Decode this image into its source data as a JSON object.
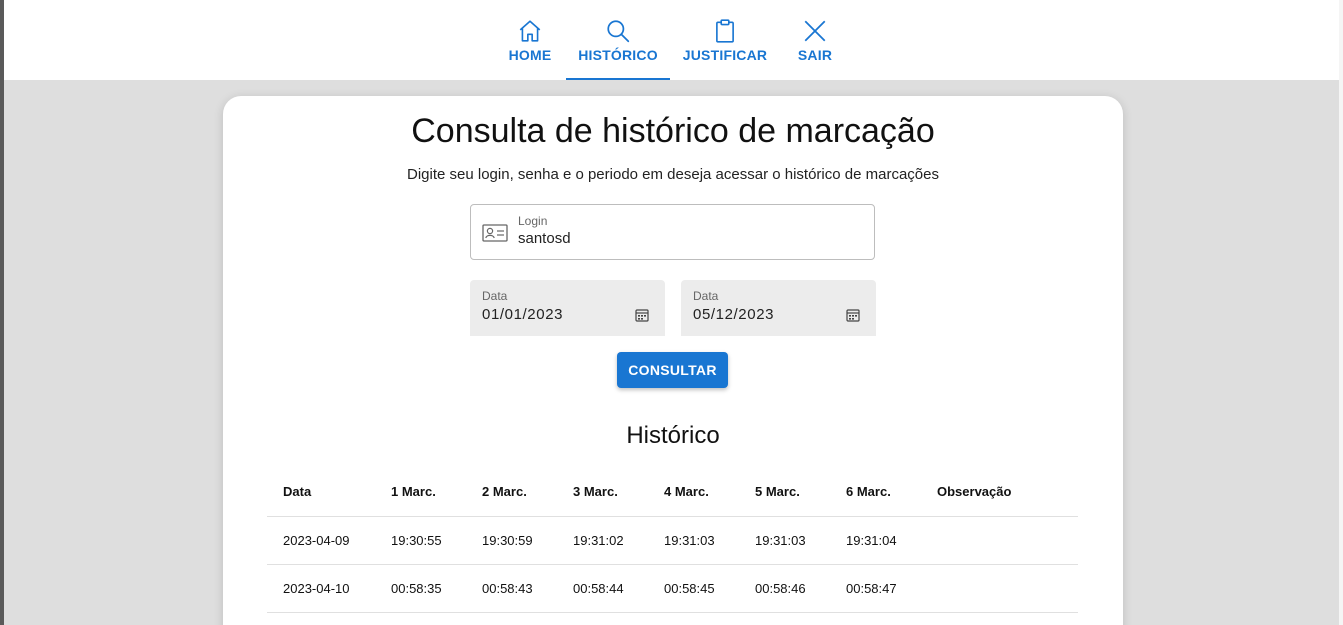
{
  "nav": {
    "tabs": [
      {
        "label": "HOME",
        "icon": "home-icon",
        "active": false
      },
      {
        "label": "HISTÓRICO",
        "icon": "search-icon",
        "active": true
      },
      {
        "label": "JUSTIFICAR",
        "icon": "clipboard-icon",
        "active": false
      },
      {
        "label": "SAIR",
        "icon": "close-icon",
        "active": false
      }
    ]
  },
  "page": {
    "title": "Consulta de histórico de marcação",
    "subtitle": "Digite seu login, senha e o periodo em deseja acessar o histórico de marcações"
  },
  "form": {
    "login": {
      "label": "Login",
      "value": "santosd",
      "icon": "id-card-icon"
    },
    "date_start": {
      "label": "Data",
      "value": "01/01/2023",
      "icon": "calendar-icon"
    },
    "date_end": {
      "label": "Data",
      "value": "05/12/2023",
      "icon": "calendar-icon"
    },
    "submit_label": "CONSULTAR"
  },
  "history": {
    "title": "Histórico",
    "columns": [
      "Data",
      "1 Marc.",
      "2 Marc.",
      "3 Marc.",
      "4 Marc.",
      "5 Marc.",
      "6 Marc.",
      "Observação"
    ],
    "rows": [
      [
        "2023-04-09",
        "19:30:55",
        "19:30:59",
        "19:31:02",
        "19:31:03",
        "19:31:03",
        "19:31:04",
        ""
      ],
      [
        "2023-04-10",
        "00:58:35",
        "00:58:43",
        "00:58:44",
        "00:58:45",
        "00:58:46",
        "00:58:47",
        ""
      ]
    ]
  },
  "colors": {
    "accent": "#1976d2",
    "background": "#dedede",
    "card": "#ffffff"
  }
}
